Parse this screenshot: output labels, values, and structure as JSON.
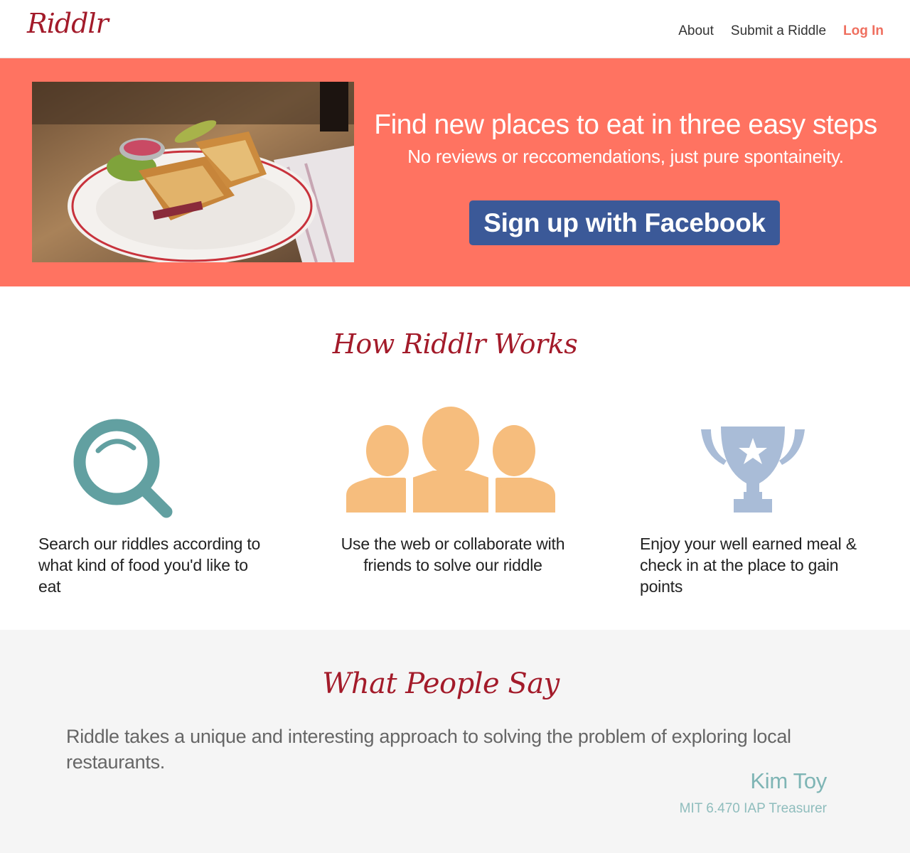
{
  "header": {
    "logo": "Riddlr",
    "nav": {
      "about": "About",
      "submit": "Submit a Riddle",
      "login": "Log In"
    }
  },
  "hero": {
    "title": "Find new places to eat in three easy steps",
    "subtitle": "No reviews or reccomendations,  just pure spontaineity.",
    "cta": "Sign up with Facebook",
    "image": "sandwich-photo"
  },
  "how": {
    "heading": "How Riddlr Works",
    "features": [
      {
        "icon": "magnifying-glass-icon",
        "text": "Search our riddles according to what kind of food you'd like to eat"
      },
      {
        "icon": "people-group-icon",
        "text": "Use the web or collaborate with friends to solve our riddle"
      },
      {
        "icon": "trophy-icon",
        "text": "Enjoy your well earned meal & check in at the place to gain points"
      }
    ]
  },
  "testimonials": {
    "heading": "What People Say",
    "quote": "Riddle takes a unique and  interesting approach to solving the problem of exploring local restaurants.",
    "author": "Kim Toy",
    "role": "MIT 6.470 IAP Treasurer"
  },
  "colors": {
    "brand": "#a31b2a",
    "hero_bg": "#ff7361",
    "facebook": "#3b5998",
    "login": "#ef6f5f",
    "search_icon": "#62a0a1",
    "people_icon": "#f6bd7d",
    "trophy_icon": "#a9bcd7",
    "author": "#7fb5b5"
  }
}
